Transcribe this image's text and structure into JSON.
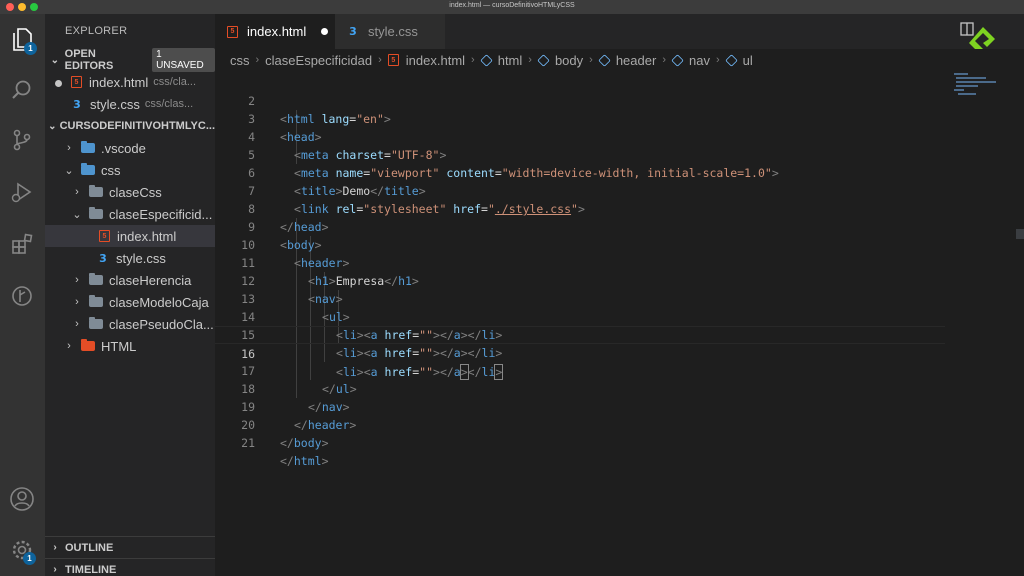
{
  "window": {
    "title": "index.html — cursoDefinitivoHTMLyCSS"
  },
  "activity_bar": {
    "explorer_badge": "1",
    "settings_badge": "1"
  },
  "sidebar": {
    "title": "EXPLORER",
    "open_editors": {
      "label": "OPEN EDITORS",
      "badge": "1 UNSAVED",
      "items": [
        {
          "name": "index.html",
          "desc": "css/cla..."
        },
        {
          "name": "style.css",
          "desc": "css/clas..."
        }
      ]
    },
    "workspace": {
      "label": "CURSODEFINITIVOHTMLYC...",
      "items": [
        {
          "name": ".vscode"
        },
        {
          "name": "css"
        },
        {
          "name": "claseCss"
        },
        {
          "name": "claseEspecificid..."
        },
        {
          "name": "index.html"
        },
        {
          "name": "style.css"
        },
        {
          "name": "claseHerencia"
        },
        {
          "name": "claseModeloCaja"
        },
        {
          "name": "clasePseudoCla..."
        },
        {
          "name": "HTML"
        }
      ]
    },
    "outline_label": "OUTLINE",
    "timeline_label": "TIMELINE"
  },
  "tabs": [
    {
      "label": "index.html",
      "active": true,
      "unsaved": true
    },
    {
      "label": "style.css",
      "active": false,
      "unsaved": false
    }
  ],
  "breadcrumb": [
    "css",
    "claseEspecificidad",
    "index.html",
    "html",
    "body",
    "header",
    "nav",
    "ul"
  ],
  "editor": {
    "line_numbers": [
      "2",
      "3",
      "4",
      "5",
      "6",
      "7",
      "8",
      "9",
      "10",
      "11",
      "12",
      "13",
      "14",
      "15",
      "16",
      "17",
      "18",
      "19",
      "20",
      "21"
    ],
    "current_line": "16",
    "code": {
      "l2": {
        "open": "<",
        "tag": "html",
        "attr": " lang",
        "eq": "=",
        "val": "\"en\"",
        "close": ">"
      },
      "l3": {
        "open": "<",
        "tag": "head",
        "close": ">"
      },
      "l4": {
        "open": "<",
        "tag": "meta",
        "attr": " charset",
        "eq": "=",
        "val": "\"UTF-8\"",
        "close": ">"
      },
      "l5": {
        "open": "<",
        "tag": "meta",
        "attr1": " name",
        "eq1": "=",
        "val1": "\"viewport\"",
        "attr2": " content",
        "eq2": "=",
        "val2": "\"width=device-width, initial-scale=1.0\"",
        "close": ">"
      },
      "l6": {
        "open": "<",
        "tag": "title",
        "mid": ">",
        "text": "Demo",
        "endopen": "</",
        "endtag": "title",
        "close": ">"
      },
      "l7": {
        "open": "<",
        "tag": "link",
        "attr1": " rel",
        "eq1": "=",
        "val1": "\"stylesheet\"",
        "attr2": " href",
        "eq2": "=",
        "q1": "\"",
        "path": "./style.css",
        "q2": "\"",
        "close": ">"
      },
      "l8": {
        "open": "</",
        "tag": "head",
        "close": ">"
      },
      "l9": {
        "open": "<",
        "tag": "body",
        "close": ">"
      },
      "l10": {
        "open": "<",
        "tag": "header",
        "close": ">"
      },
      "l11": {
        "open": "<",
        "tag": "h1",
        "mid": ">",
        "text": "Empresa",
        "endopen": "</",
        "endtag": "h1",
        "close": ">"
      },
      "l12": {
        "open": "<",
        "tag": "nav",
        "close": ">"
      },
      "l13": {
        "open": "<",
        "tag": "ul",
        "close": ">"
      },
      "l14": {
        "open": "<",
        "tag": "li",
        "mid": "><",
        "tag2": "a",
        "attr": " href",
        "eq": "=",
        "val": "\"\"",
        "mid2": "></",
        "tag3": "a",
        "mid3": "></",
        "tag4": "li",
        "close": ">"
      },
      "l15": {
        "open": "<",
        "tag": "li",
        "mid": "><",
        "tag2": "a",
        "attr": " href",
        "eq": "=",
        "val": "\"\"",
        "mid2": "></",
        "tag3": "a",
        "mid3": "></",
        "tag4": "li",
        "close": ">"
      },
      "l16": {
        "open": "<",
        "tag": "li",
        "mid": "><",
        "tag2": "a",
        "attr": " href",
        "eq": "=",
        "val": "\"\"",
        "mid2": "></",
        "tag3": "a",
        "mid3a": ">",
        "mid3b": "</",
        "tag4": "li",
        "close": ">"
      },
      "l17": {
        "open": "</",
        "tag": "ul",
        "close": ">"
      },
      "l18": {
        "open": "</",
        "tag": "nav",
        "close": ">"
      },
      "l19": {
        "open": "</",
        "tag": "header",
        "close": ">"
      },
      "l20": {
        "open": "</",
        "tag": "body",
        "close": ">"
      },
      "l21": {
        "open": "</",
        "tag": "html",
        "close": ">"
      }
    }
  },
  "colors": {
    "tag": "#569cd6",
    "attribute": "#9cdcfe",
    "string": "#ce9178",
    "bracket": "#808080",
    "html_icon": "#e44d26",
    "css_icon": "#42a5f5",
    "logo": "#7ed321"
  },
  "icons": {
    "activity_bar": [
      "files-icon",
      "search-icon",
      "source-control-icon",
      "run-debug-icon",
      "extensions-icon",
      "git-graph-icon",
      "account-icon",
      "settings-gear-icon"
    ]
  }
}
